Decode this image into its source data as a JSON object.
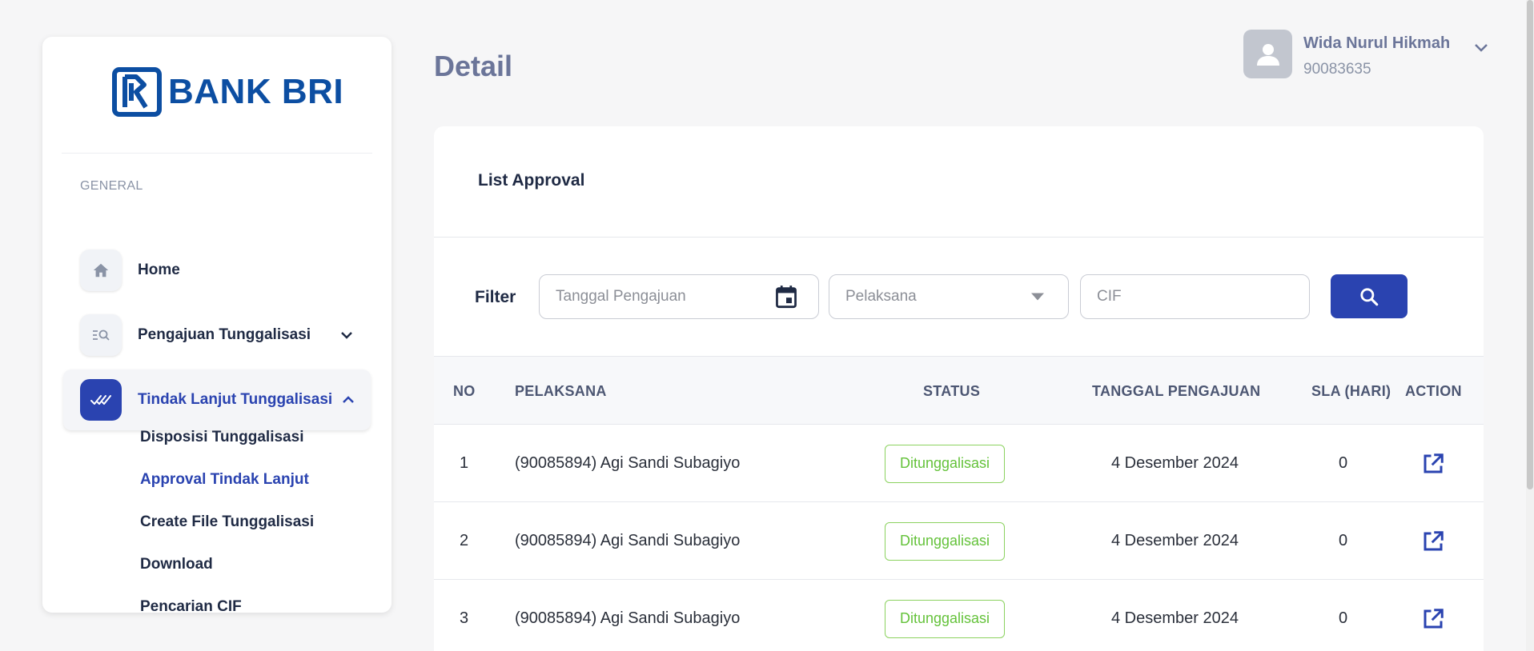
{
  "brand": {
    "logo_text": "BANK BRI",
    "color": "#0c4ea2"
  },
  "sidebar": {
    "section": "GENERAL",
    "items": [
      {
        "label": "Home",
        "icon": "home-icon"
      },
      {
        "label": "Pengajuan Tunggalisasi",
        "icon": "list-search-icon"
      },
      {
        "label": "Tindak Lanjut Tunggalisasi",
        "icon": "double-check-icon"
      }
    ],
    "subitems": [
      {
        "label": "Disposisi Tunggalisasi"
      },
      {
        "label": "Approval Tindak Lanjut"
      },
      {
        "label": "Create File Tunggalisasi"
      },
      {
        "label": "Download"
      },
      {
        "label": "Pencarian CIF"
      }
    ]
  },
  "header": {
    "title": "Detail"
  },
  "user": {
    "name": "Wida Nurul Hikmah",
    "id": "90083635"
  },
  "card": {
    "title": "List Approval",
    "filter": {
      "label": "Filter",
      "date_placeholder": "Tanggal Pengajuan",
      "pelaksana_placeholder": "Pelaksana",
      "cif_placeholder": "CIF"
    },
    "columns": [
      "NO",
      "PELAKSANA",
      "STATUS",
      "TANGGAL PENGAJUAN",
      "SLA (HARI)",
      "ACTION"
    ],
    "rows": [
      {
        "no": "1",
        "pelaksana": "(90085894) Agi Sandi Subagiyo",
        "status": "Ditunggalisasi",
        "tanggal": "4 Desember 2024",
        "sla": "0"
      },
      {
        "no": "2",
        "pelaksana": "(90085894) Agi Sandi Subagiyo",
        "status": "Ditunggalisasi",
        "tanggal": "4 Desember 2024",
        "sla": "0"
      },
      {
        "no": "3",
        "pelaksana": "(90085894) Agi Sandi Subagiyo",
        "status": "Ditunggalisasi",
        "tanggal": "4 Desember 2024",
        "sla": "0"
      }
    ]
  },
  "colors": {
    "accent": "#2a43b0",
    "status_ok": "#64c23a",
    "muted": "#6b7599"
  }
}
